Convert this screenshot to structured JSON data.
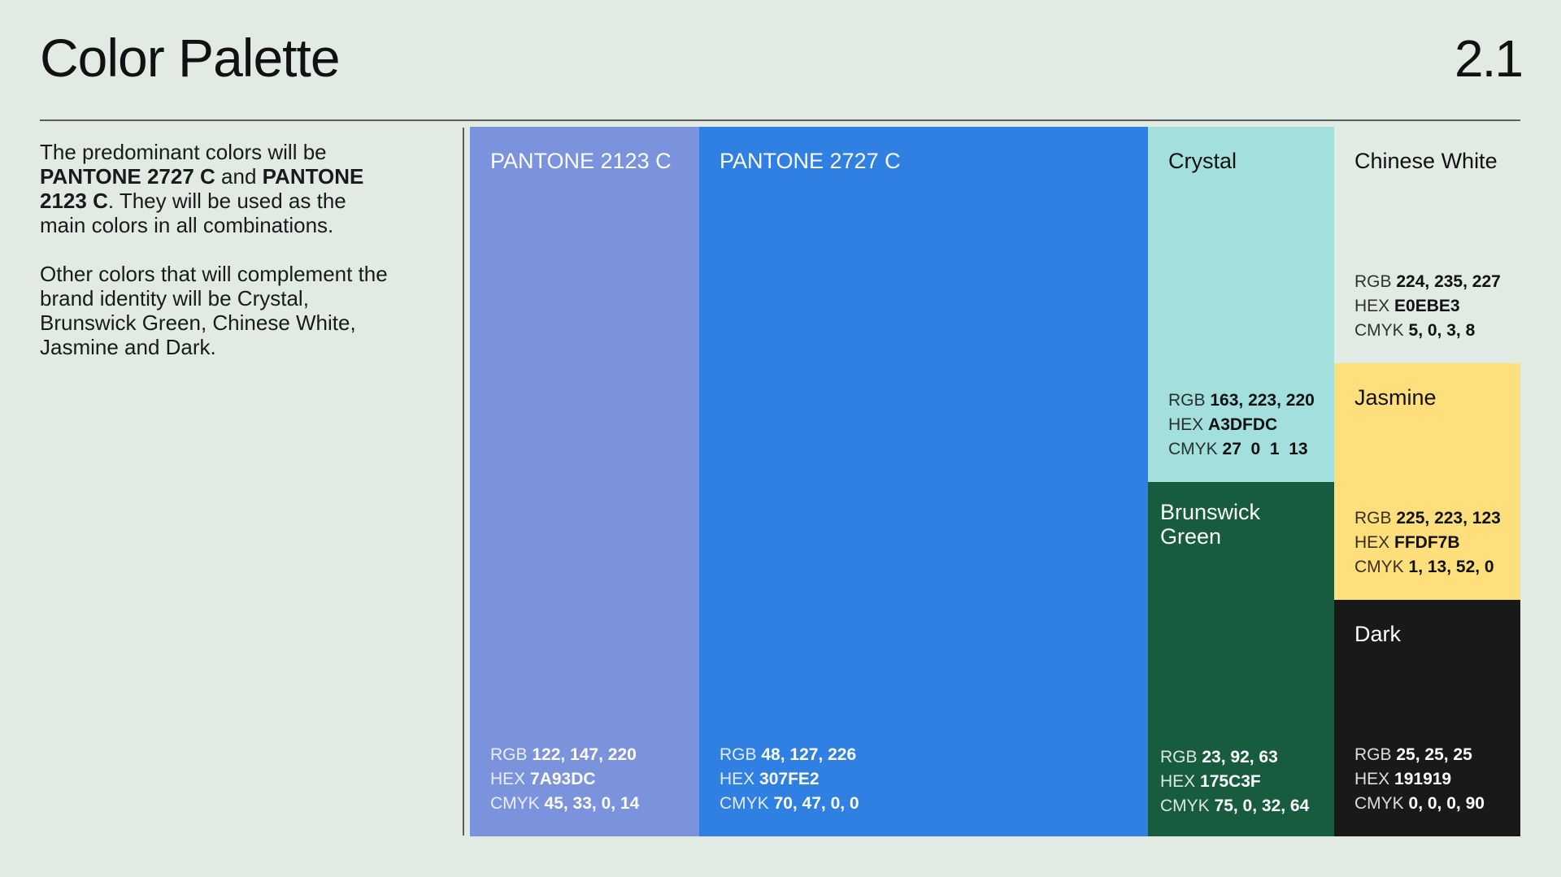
{
  "header": {
    "title": "Color Palette",
    "section_number": "2.1"
  },
  "intro": {
    "p1_part1": "The predominant colors will be ",
    "p1_bold1": "PANTONE 2727 C",
    "p1_part2": " and ",
    "p1_bold2": "PANTONE 2123 C",
    "p1_part3": ". They will be used as the main colors in all combinations.",
    "p2": "Other colors that will complement the brand identity will be Crystal, Brunswick Green, Chinese White, Jasmine and Dark."
  },
  "labels": {
    "rgb": "RGB",
    "hex": "HEX",
    "cmyk": "CMYK"
  },
  "swatches": [
    {
      "name": "PANTONE 2123 C",
      "rgb": "122, 147, 220",
      "hex": "7A93DC",
      "cmyk": "45, 33, 0, 14",
      "color": "#7A93DC",
      "text_color": "#FFFFFF"
    },
    {
      "name": "PANTONE 2727 C",
      "rgb": "48, 127, 226",
      "hex": "307FE2",
      "cmyk": "70, 47, 0, 0",
      "color": "#307FE2",
      "text_color": "#FFFFFF"
    },
    {
      "name": "Crystal",
      "rgb": "163, 223, 220",
      "hex": "A3DFDC",
      "cmyk": "27  0  1  13",
      "color": "#A3DFDC",
      "text_color": "#111111"
    },
    {
      "name": "Brunswick Green",
      "rgb": "23, 92, 63",
      "hex": "175C3F",
      "cmyk": "75, 0, 32, 64",
      "color": "#175C3F",
      "text_color": "#FFFFFF"
    },
    {
      "name": "Chinese White",
      "rgb": "224, 235, 227",
      "hex": "E0EBE3",
      "cmyk": "5, 0, 3, 8",
      "color": "#E0EBE3",
      "text_color": "#111111"
    },
    {
      "name": "Jasmine",
      "rgb": "225, 223, 123",
      "hex": "FFDF7B",
      "cmyk": "1, 13, 52, 0",
      "color": "#FFDF7B",
      "text_color": "#111111"
    },
    {
      "name": "Dark",
      "rgb": "25, 25, 25",
      "hex": "191919",
      "cmyk": "0, 0, 0, 90",
      "color": "#191919",
      "text_color": "#FFFFFF"
    }
  ]
}
